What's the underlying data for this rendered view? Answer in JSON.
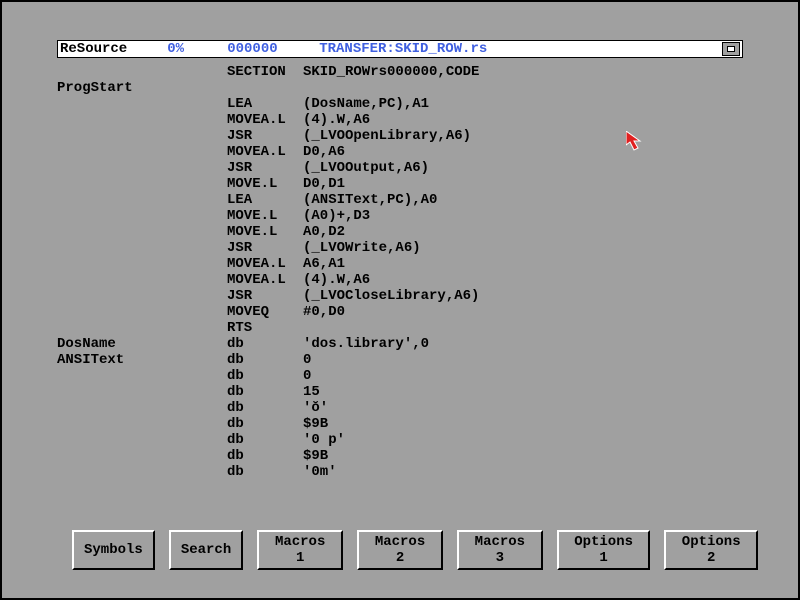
{
  "titlebar": {
    "app": "ReSource",
    "percent": "0%",
    "address": "000000",
    "path": "TRANSFER:SKID_ROW.rs"
  },
  "lines": [
    {
      "label": "",
      "op": "SECTION",
      "args": "SKID_ROWrs000000,CODE"
    },
    {
      "label": "ProgStart",
      "op": "",
      "args": ""
    },
    {
      "label": "",
      "op": "LEA",
      "args": "(DosName,PC),A1"
    },
    {
      "label": "",
      "op": "MOVEA.L",
      "args": "(4).W,A6"
    },
    {
      "label": "",
      "op": "JSR",
      "args": "(_LVOOpenLibrary,A6)"
    },
    {
      "label": "",
      "op": "MOVEA.L",
      "args": "D0,A6"
    },
    {
      "label": "",
      "op": "JSR",
      "args": "(_LVOOutput,A6)"
    },
    {
      "label": "",
      "op": "MOVE.L",
      "args": "D0,D1"
    },
    {
      "label": "",
      "op": "LEA",
      "args": "(ANSIText,PC),A0"
    },
    {
      "label": "",
      "op": "MOVE.L",
      "args": "(A0)+,D3"
    },
    {
      "label": "",
      "op": "MOVE.L",
      "args": "A0,D2"
    },
    {
      "label": "",
      "op": "JSR",
      "args": "(_LVOWrite,A6)"
    },
    {
      "label": "",
      "op": "MOVEA.L",
      "args": "A6,A1"
    },
    {
      "label": "",
      "op": "MOVEA.L",
      "args": "(4).W,A6"
    },
    {
      "label": "",
      "op": "JSR",
      "args": "(_LVOCloseLibrary,A6)"
    },
    {
      "label": "",
      "op": "MOVEQ",
      "args": "#0,D0"
    },
    {
      "label": "",
      "op": "RTS",
      "args": ""
    },
    {
      "label": "",
      "op": "",
      "args": ""
    },
    {
      "label": "DosName",
      "op": "db",
      "args": "'dos.library',0"
    },
    {
      "label": "ANSIText",
      "op": "db",
      "args": "0"
    },
    {
      "label": "",
      "op": "db",
      "args": "0"
    },
    {
      "label": "",
      "op": "db",
      "args": "15"
    },
    {
      "label": "",
      "op": "db",
      "args": "'ŏ'"
    },
    {
      "label": "",
      "op": "db",
      "args": "$9B"
    },
    {
      "label": "",
      "op": "db",
      "args": "'0 p'"
    },
    {
      "label": "",
      "op": "db",
      "args": "$9B"
    },
    {
      "label": "",
      "op": "db",
      "args": "'0m'"
    }
  ],
  "buttons": {
    "b0": "Symbols",
    "b1": "Search",
    "b2": "Macros 1",
    "b3": "Macros 2",
    "b4": "Macros 3",
    "b5": "Options 1",
    "b6": "Options 2"
  }
}
